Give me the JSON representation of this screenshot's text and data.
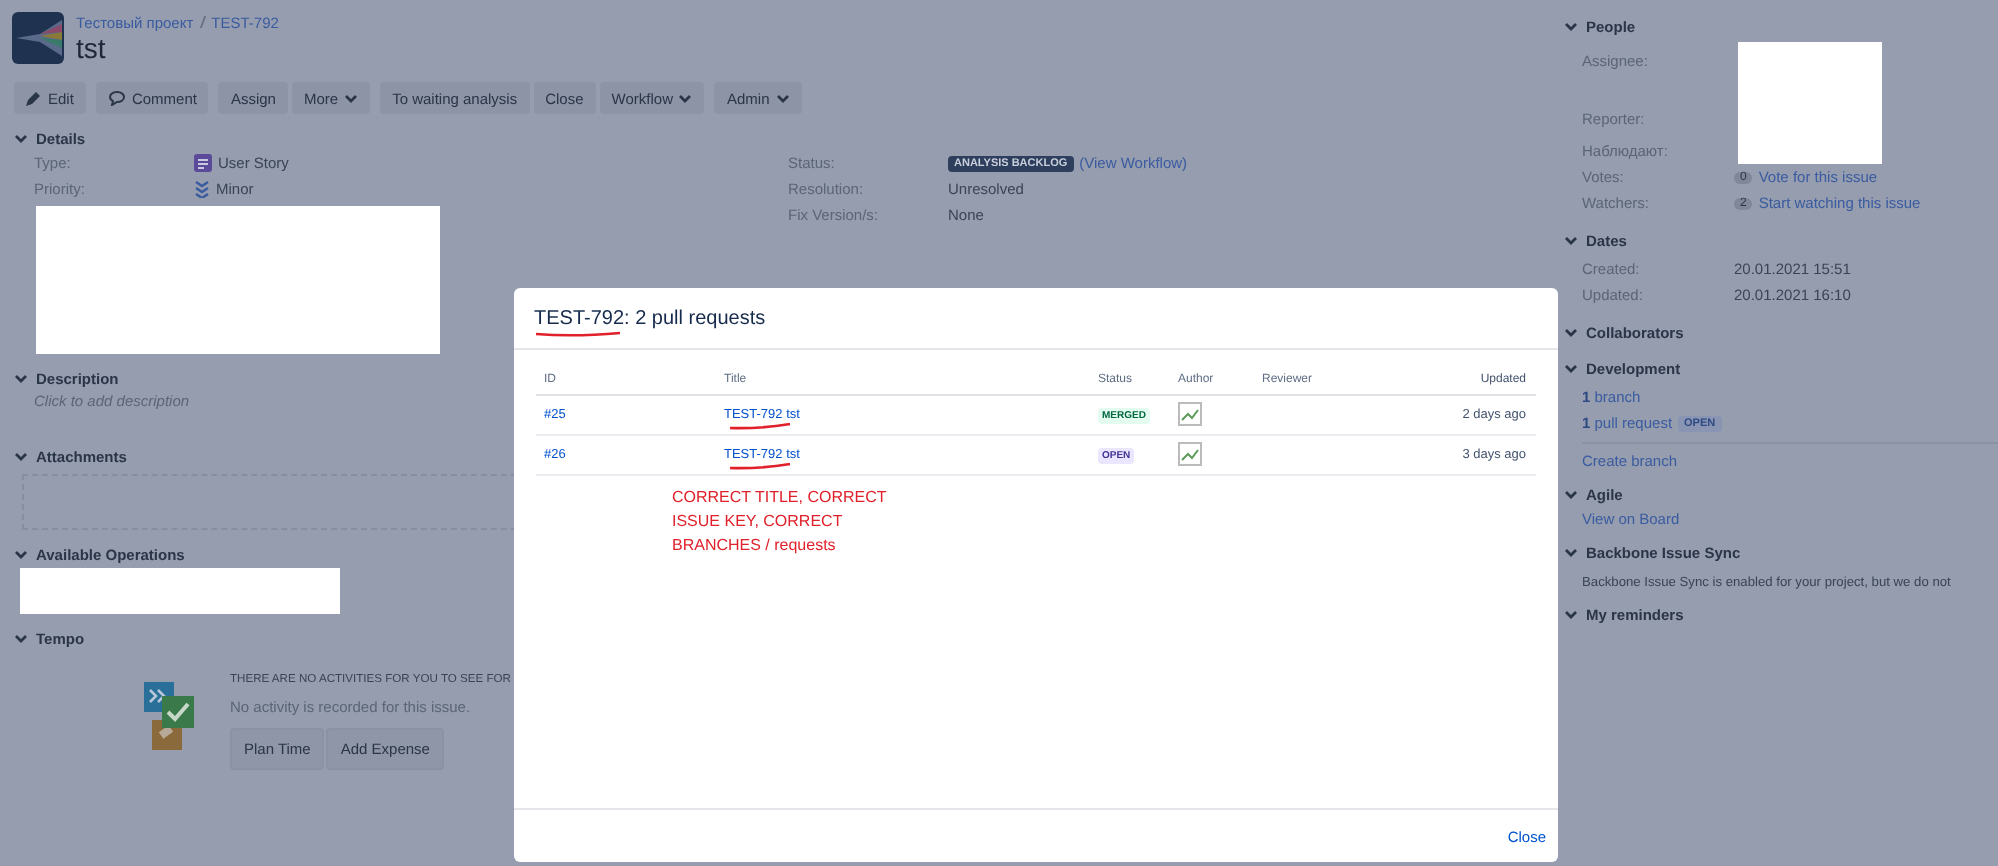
{
  "breadcrumbs": [
    "Тестовый проект",
    "TEST-792"
  ],
  "issue_title": "tst",
  "toolbar": [
    [
      {
        "label": "Edit",
        "caret": false
      }
    ],
    [
      {
        "label": "Comment",
        "caret": false
      }
    ],
    [
      {
        "label": "Assign",
        "caret": false
      },
      {
        "label": "More",
        "caret": true
      }
    ],
    [
      {
        "label": "To waiting analysis",
        "caret": false
      },
      {
        "label": "Close",
        "caret": false
      },
      {
        "label": "Workflow",
        "caret": true
      }
    ],
    [
      {
        "label": "Admin",
        "caret": true
      }
    ]
  ],
  "details": {
    "title": "Details",
    "expanded": true,
    "left_fields": [
      {
        "label": "Type:",
        "value": "User Story"
      },
      {
        "label": "Priority:",
        "value": "Minor"
      }
    ],
    "status": {
      "label": "Status:",
      "lozenge": "ANALYSIS BACKLOG",
      "link": "(View Workflow)"
    },
    "right_fields": [
      {
        "label": "Resolution:",
        "value": "Unresolved"
      },
      {
        "label": "Fix Version/s:",
        "value": "None"
      }
    ]
  },
  "description": {
    "title": "Description",
    "expanded": true,
    "placeholder": "Click to add description"
  },
  "attachments": {
    "title": "Attachments",
    "expanded": true
  },
  "available_operations": {
    "title": "Available Operations",
    "expanded": true
  },
  "tempo": {
    "title": "Tempo",
    "expanded": true,
    "heading": "THERE ARE NO ACTIVITIES FOR YOU TO SEE FOR",
    "message": "No activity is recorded for this issue.",
    "buttons": [
      "Plan Time",
      "Add Expense"
    ]
  },
  "sidebar": {
    "people": {
      "title": "People",
      "expanded": true,
      "labels": [
        "Assignee:",
        "Reporter:",
        "Наблюдают:"
      ],
      "votes": {
        "label": "Votes:",
        "count": "0",
        "link": "Vote for this issue"
      },
      "watchers": {
        "label": "Watchers:",
        "count": "2",
        "link": "Start watching this issue"
      }
    },
    "dates": {
      "title": "Dates",
      "expanded": true,
      "rows": [
        {
          "label": "Created:",
          "value": "20.01.2021 15:51"
        },
        {
          "label": "Updated:",
          "value": "20.01.2021 16:10"
        }
      ]
    },
    "collaborators": {
      "title": "Collaborators",
      "expanded": true
    },
    "development": {
      "title": "Development",
      "expanded": true,
      "items": [
        {
          "count": "1",
          "link": "branch"
        },
        {
          "count": "1",
          "link": "pull request",
          "lozenge": "OPEN"
        }
      ],
      "create_link": "Create branch"
    },
    "agile": {
      "title": "Agile",
      "expanded": true,
      "link": "View on Board"
    },
    "backbone": {
      "title": "Backbone Issue Sync",
      "expanded": true,
      "text": "Backbone Issue Sync is enabled for your project, but we do not"
    },
    "reminders": {
      "title": "My reminders",
      "expanded": true
    }
  },
  "dialog": {
    "title_key": "TEST-792",
    "title_rest": ": 2 pull requests",
    "columns": [
      "ID",
      "Title",
      "Status",
      "Author",
      "Reviewer",
      "Updated"
    ],
    "rows": [
      {
        "id": "#25",
        "title_key": "TEST-792",
        "title_rest": "tst",
        "status": "MERGED",
        "kind": "merged",
        "updated": "2 days ago"
      },
      {
        "id": "#26",
        "title_key": "TEST-792",
        "title_rest": "tst",
        "status": "OPEN",
        "kind": "open",
        "updated": "3 days ago"
      }
    ],
    "annotation": [
      "CORRECT TITLE, CORRECT",
      "ISSUE KEY, CORRECT",
      "BRANCHES / requests"
    ],
    "close": "Close"
  }
}
